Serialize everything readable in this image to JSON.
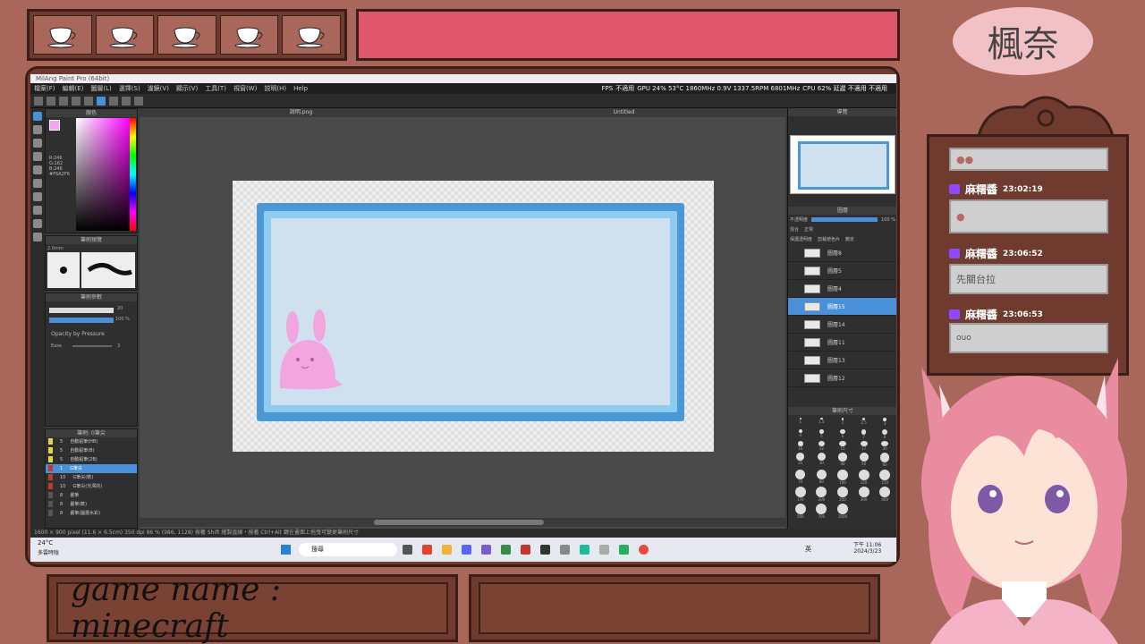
{
  "logo": {
    "text": "楓奈"
  },
  "window": {
    "title": "MilAng Paint Pro (64bit)"
  },
  "menu": [
    "檔案(F)",
    "編輯(E)",
    "圖層(L)",
    "選擇(S)",
    "濾鏡(V)",
    "顯示(V)",
    "工具(T)",
    "視窗(W)",
    "説明(H)",
    "Help"
  ],
  "stats": {
    "fps": "FPS",
    "fps_value": "不適用",
    "gpu": "GPU 24% 53°C 1860MHz 0.9V 1337.5RPM 6801MHz",
    "cpu": "CPU 62% 延遲 不適用 不適用"
  },
  "tabs": [
    "說明.png",
    "Untitled"
  ],
  "panels": {
    "color": "顏色",
    "brush_preview": "筆刷預覽",
    "brush_size": "筆刷參數",
    "opacity_label": "Opacity by Pressure",
    "navigator": "導覽",
    "layers": "圖層",
    "brush_sizes": "筆刷尺寸",
    "brush_list": "筆刷: 0筆尖"
  },
  "color_values": {
    "r": "R:246",
    "g": "G:162",
    "b": "B:246",
    "hex": "#F6A2F6"
  },
  "brush_size_value": "2.0mm",
  "brush_params": {
    "size_value": "20",
    "opacity_value": "100 %",
    "ease_label": "Ease",
    "ease_value": "3"
  },
  "layers": {
    "opacity_label": "不透明度",
    "opacity_value": "100 %",
    "blend_label": "混合",
    "blend_value": "正常",
    "protect_alpha": "保護透明度",
    "clipping": "剪裁遮色片",
    "lock": "鎖定",
    "items": [
      {
        "name": "圖層8",
        "on": false
      },
      {
        "name": "圖層5",
        "on": false
      },
      {
        "name": "圖層4",
        "on": false
      },
      {
        "name": "圖層15",
        "on": true
      },
      {
        "name": "圖層14",
        "on": false
      },
      {
        "name": "圖層11",
        "on": false
      },
      {
        "name": "圖層13",
        "on": false
      },
      {
        "name": "圖層12",
        "on": false
      }
    ]
  },
  "brushes": [
    {
      "size": "5",
      "name": "自動鉛筆(HB)"
    },
    {
      "size": "5",
      "name": "自動鉛筆(B)"
    },
    {
      "size": "5",
      "name": "自動鉛筆(2B)"
    },
    {
      "size": "1",
      "name": "G筆尖"
    },
    {
      "size": "10",
      "name": "G筆尖(軟)"
    },
    {
      "size": "10",
      "name": "G筆尖(光澤的)"
    },
    {
      "size": "8",
      "name": "畫筆"
    },
    {
      "size": "8",
      "name": "畫筆(軟)"
    },
    {
      "size": "8",
      "name": "畫筆(圖層水彩)"
    }
  ],
  "status_text": "1600 × 900 pixel (11.6 × 6.5cm) 350 dpi 86 % (986, 1128) 按著 Shift 繪製直線・按著 Ctrl+Alt 鍵在畫面上拖曳可變更筆刷尺寸",
  "taskbar": {
    "temp": "24°C",
    "weather": "多雲時陰",
    "search": "搜尋",
    "ime": "英",
    "time": "下午 11:06",
    "date": "2024/3/23"
  },
  "brush_size_grid": [
    "1",
    "1.5",
    "2",
    "2.5",
    "3",
    "4",
    "5",
    "6",
    "7",
    "8",
    "10",
    "12",
    "15",
    "17",
    "20",
    "25",
    "30",
    "40",
    "50",
    "60",
    "70",
    "80",
    "100",
    "120",
    "150",
    "170",
    "200",
    "250",
    "300",
    "400",
    "500",
    "700",
    "1000"
  ],
  "game": {
    "label": "game name : minecraft"
  },
  "chat": [
    {
      "user": "麻糬醬",
      "time": "23:02:19",
      "text": ""
    },
    {
      "user": "麻糬醬",
      "time": "23:06:52",
      "text": "先關台拉"
    },
    {
      "user": "麻糬醬",
      "time": "23:06:53",
      "text": "ouo"
    }
  ]
}
